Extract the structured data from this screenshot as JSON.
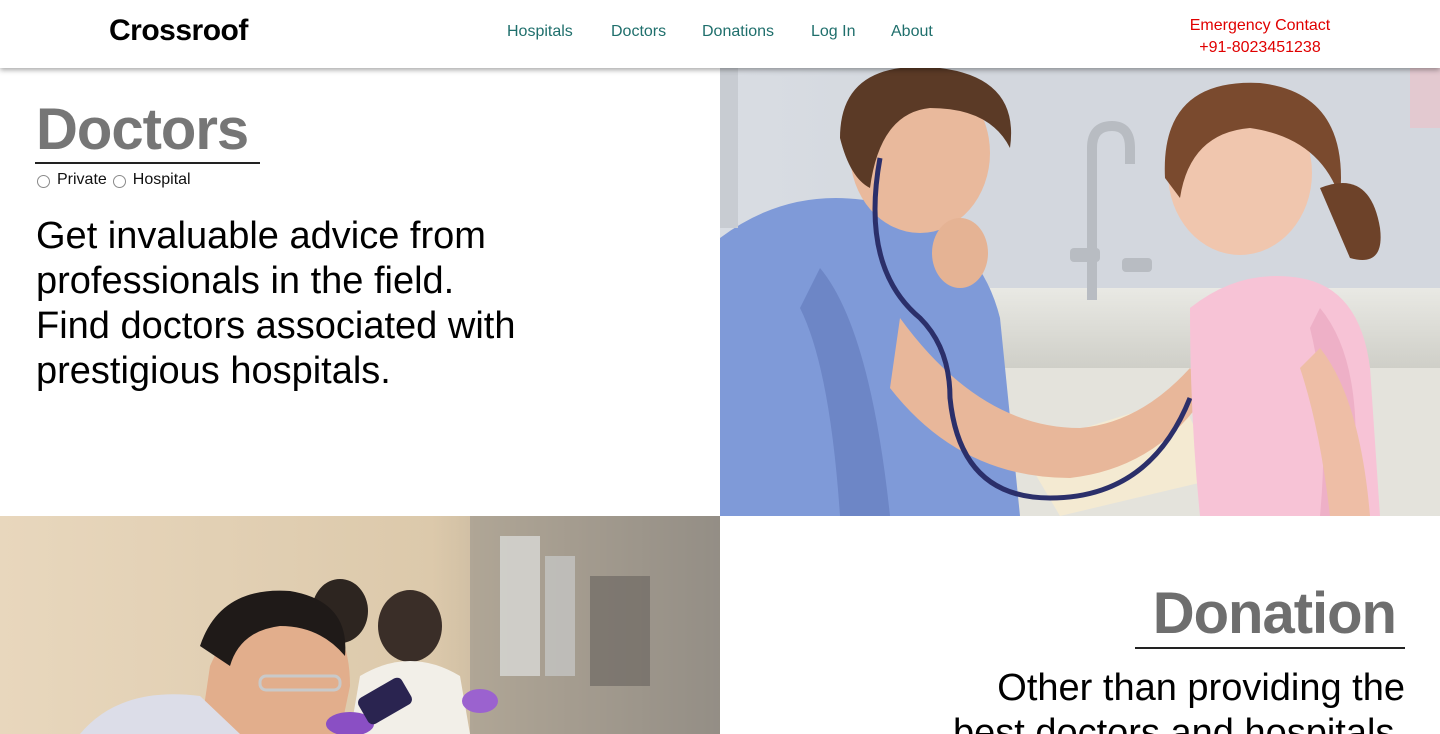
{
  "header": {
    "logo": "Crossroof",
    "nav": [
      "Hospitals",
      "Doctors",
      "Donations",
      "Log In",
      "About"
    ],
    "emergency_label": "Emergency Contact",
    "emergency_phone": "+91-8023451238"
  },
  "doctors": {
    "title": "Doctors",
    "filter_options": [
      "Private",
      "Hospital"
    ],
    "description_lines": [
      "Get invaluable advice from",
      "professionals in the field.",
      "Find doctors associated with",
      "prestigious hospitals."
    ]
  },
  "donation": {
    "title": "Donation",
    "description_lines": [
      "Other than providing the",
      "best doctors and hospitals,"
    ]
  },
  "colors": {
    "nav_link": "#1f6f6c",
    "emergency": "#e00000",
    "section_title": "#767676"
  },
  "images": {
    "hero_photo": "nurse-examining-child-photo",
    "lab_photo": "lab-researchers-photo"
  }
}
